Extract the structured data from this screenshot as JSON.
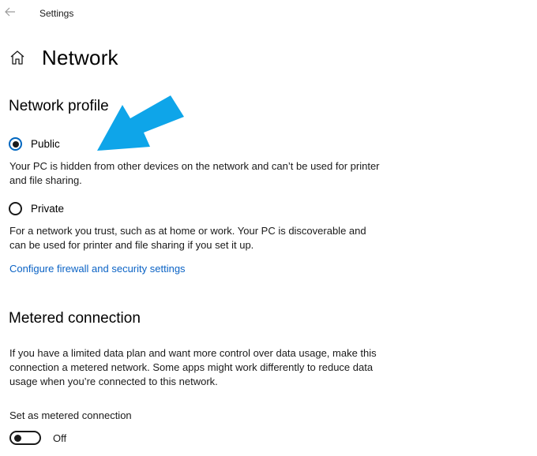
{
  "window": {
    "app_title": "Settings"
  },
  "header": {
    "title": "Network"
  },
  "network_profile": {
    "section_title": "Network profile",
    "public": {
      "label": "Public",
      "selected": true,
      "description": "Your PC is hidden from other devices on the network and can’t be used for printer and file sharing."
    },
    "private": {
      "label": "Private",
      "selected": false,
      "description": "For a network you trust, such as at home or work. Your PC is discoverable and can be used for printer and file sharing if you set it up."
    },
    "firewall_link": "Configure firewall and security settings"
  },
  "metered": {
    "section_title": "Metered connection",
    "description": "If you have a limited data plan and want more control over data usage, make this connection a metered network. Some apps might work differently to reduce data usage when you’re connected to this network.",
    "setting_label": "Set as metered connection",
    "toggle_state": "Off",
    "toggle_on": false
  },
  "colors": {
    "accent": "#0067c0",
    "link": "#0b63c5",
    "annotation_arrow": "#0ea5e9"
  },
  "icons": {
    "back": "back-arrow-icon",
    "home": "home-icon",
    "annotation": "annotation-arrow"
  }
}
